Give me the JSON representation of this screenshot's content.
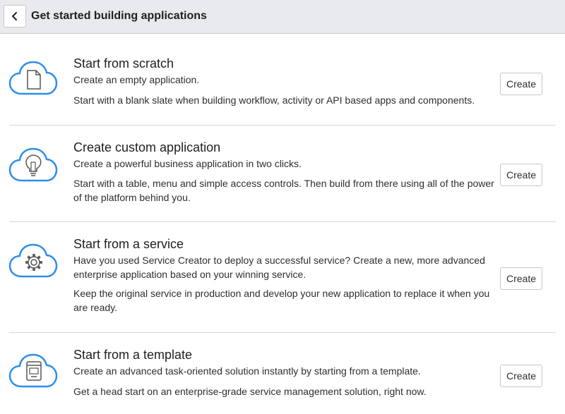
{
  "header": {
    "title": "Get started building applications",
    "back_icon": "chevron-left-icon"
  },
  "colors": {
    "accent": "#2f8eee",
    "header_bg": "#e8eaed",
    "divider": "#d3d5d9"
  },
  "options": [
    {
      "icon": "cloud-document-icon",
      "title": "Start from scratch",
      "line1": "Create an empty application.",
      "line2": "Start with a blank slate when building workflow, activity or API based apps and components.",
      "button": "Create"
    },
    {
      "icon": "cloud-lightbulb-icon",
      "title": "Create custom application",
      "line1": "Create a powerful business application in two clicks.",
      "line2": "Start with a table, menu and simple access controls. Then build from there using all of the power of the platform behind you.",
      "button": "Create"
    },
    {
      "icon": "cloud-gear-icon",
      "title": "Start from a service",
      "line1": "Have you used Service Creator to deploy a successful service? Create a new, more advanced enterprise application based on your winning service.",
      "line2": "Keep the original service in production and develop your new application to replace it when you are ready.",
      "button": "Create"
    },
    {
      "icon": "cloud-template-icon",
      "title": "Start from a template",
      "line1": "Create an advanced task-oriented solution instantly by starting from a template.",
      "line2": "Get a head start on an enterprise-grade service management solution, right now.",
      "button": "Create"
    }
  ]
}
